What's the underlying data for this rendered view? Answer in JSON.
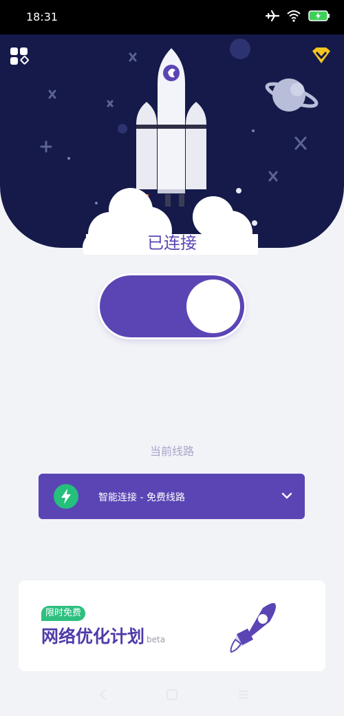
{
  "status_bar": {
    "time": "18:31",
    "icons": [
      "airplane-icon",
      "wifi-icon",
      "battery-icon"
    ]
  },
  "hero": {
    "apps_icon": "apps-icon",
    "vip_icon": "vip-diamond-icon",
    "status_text": "已连接"
  },
  "toggle": {
    "state": "on",
    "color": "#5b45b5"
  },
  "route": {
    "label": "当前线路",
    "selected": "智能连接 - 免费线路",
    "icon": "lightning-icon"
  },
  "promo": {
    "badge": "限时免费",
    "title": "网络优化计划",
    "beta": "beta",
    "icon": "rocket-icon"
  },
  "colors": {
    "primary": "#5b45b5",
    "hero_bg": "#151a4a",
    "accent_green": "#25c07c",
    "page_bg": "#f2f3f7"
  }
}
